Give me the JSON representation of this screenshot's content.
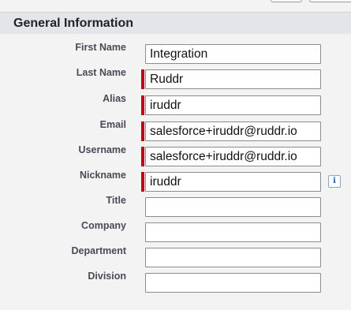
{
  "section": {
    "title": "General Information"
  },
  "fields": [
    {
      "label": "First Name",
      "value": "Integration",
      "required": false
    },
    {
      "label": "Last Name",
      "value": "Ruddr",
      "required": true
    },
    {
      "label": "Alias",
      "value": "iruddr",
      "required": true
    },
    {
      "label": "Email",
      "value": "salesforce+iruddr@ruddr.io",
      "required": true
    },
    {
      "label": "Username",
      "value": "salesforce+iruddr@ruddr.io",
      "required": true
    },
    {
      "label": "Nickname",
      "value": "iruddr",
      "required": true
    },
    {
      "label": "Title",
      "value": "",
      "required": false
    },
    {
      "label": "Company",
      "value": "",
      "required": false
    },
    {
      "label": "Department",
      "value": "",
      "required": false
    },
    {
      "label": "Division",
      "value": "",
      "required": false
    }
  ],
  "nickname_info": {
    "icon": "info-icon",
    "glyph": "i"
  },
  "colors": {
    "required_marker": "#c00013",
    "header_bg": "#e3e5ea",
    "page_bg": "#f3f3f3"
  }
}
